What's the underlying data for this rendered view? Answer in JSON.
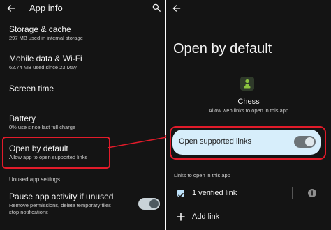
{
  "left": {
    "header": {
      "back_icon": "arrow-left-icon",
      "title": "App info",
      "search_icon": "search-icon"
    },
    "items": [
      {
        "title": "Storage & cache",
        "subtitle": "297 MB used in internal storage"
      },
      {
        "title": "Mobile data & Wi-Fi",
        "subtitle": "62.74 MB used since 23 May"
      },
      {
        "title": "Screen time",
        "subtitle": ""
      },
      {
        "title": "Battery",
        "subtitle": "0% use since last full charge"
      },
      {
        "title": "Open by default",
        "subtitle": "Allow app to open supported links"
      }
    ],
    "section_header": "Unused app settings",
    "pause": {
      "title": "Pause app activity if unused",
      "subtitle_line1": "Remove permissions, delete temporary files",
      "subtitle_line2": "stop notifications",
      "toggle_on": true
    }
  },
  "right": {
    "header": {
      "back_icon": "arrow-left-icon"
    },
    "title": "Open by default",
    "app": {
      "icon": "chess-pawn-icon",
      "name": "Chess",
      "description": "Allow web links to open in this app"
    },
    "open_supported_links": {
      "label": "Open supported links",
      "toggle_on": true
    },
    "links_header": "Links to open in this app",
    "verified_link": {
      "label": "1 verified link",
      "checked": true,
      "info_icon": "info-icon"
    },
    "add_link": {
      "label": "Add link",
      "icon": "plus-icon"
    }
  },
  "colors": {
    "background": "#141414",
    "annotation_red": "#e21b2a",
    "card_background": "#d7eefb",
    "toggle_track_dark": "#c9d3d8",
    "toggle_track_card": "#6c7377",
    "checkbox_blue": "#bfe3fb"
  }
}
